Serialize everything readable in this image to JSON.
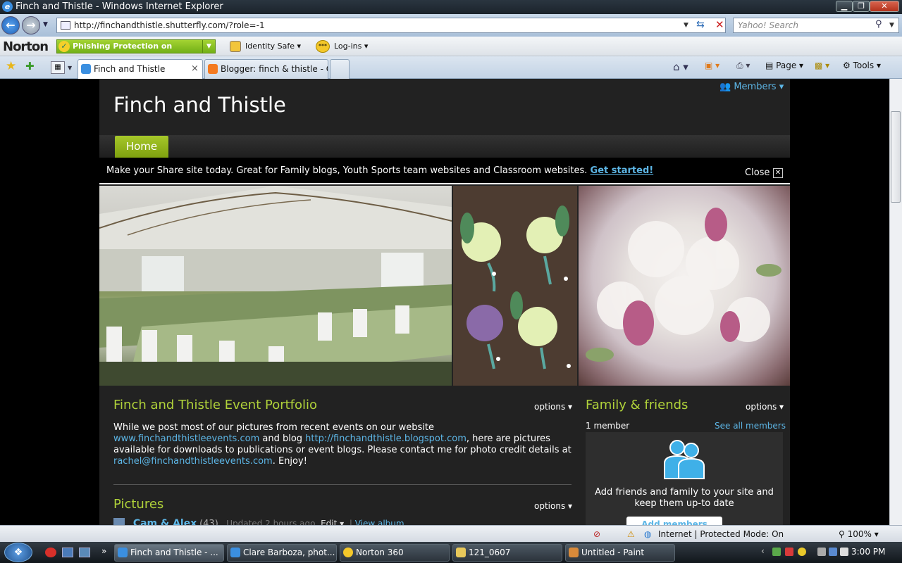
{
  "window": {
    "title": "Finch and Thistle - Windows Internet Explorer"
  },
  "nav": {
    "url": "http://finchandthistle.shutterfly.com/?role=-1",
    "search_placeholder": "Yahoo! Search"
  },
  "norton": {
    "logo": "Norton",
    "phishing": "Phishing Protection on",
    "identity_safe": "Identity Safe",
    "logins": "Log-ins"
  },
  "tabs": [
    {
      "label": "Finch and Thistle",
      "active": true
    },
    {
      "label": "Blogger: finch & thistle - C...",
      "active": false
    }
  ],
  "commands": {
    "page": "Page",
    "tools": "Tools"
  },
  "site": {
    "title": "Finch and Thistle",
    "members_menu": "Members",
    "home_tab": "Home",
    "promo_text": "Make your Share site today. Great for Family blogs, Youth Sports team websites and Classroom websites.",
    "promo_link": "Get started!",
    "promo_close": "Close",
    "portfolio": {
      "title": "Finch and Thistle Event Portfolio",
      "options": "options",
      "text1": "While we post most of our pictures from recent events on our website ",
      "link1": "www.finchandthistleevents.com",
      "text2": " and blog ",
      "link2": "http://finchandthistle.blogspot.com",
      "text3": ", here are pictures available for downloads to publications or event blogs. Please contact me for photo credit details at ",
      "link3": "rachel@finchandthistleevents.com",
      "text4": ". Enjoy!"
    },
    "pictures": {
      "title": "Pictures",
      "options": "options",
      "album_name": "Cam & Alex",
      "album_count": "(43)",
      "album_updated": "Updated 2 hours ago",
      "album_edit": "Edit",
      "album_view": "View album"
    },
    "family": {
      "title": "Family & friends",
      "options": "options",
      "count": "1 member",
      "see_all": "See all members",
      "message": "Add friends and family to your site and keep them up-to date",
      "add_button": "Add members"
    }
  },
  "status": {
    "zone": "Internet | Protected Mode: On",
    "zoom": "100%"
  },
  "taskbar": {
    "items": [
      {
        "label": "Finch and Thistle - ..."
      },
      {
        "label": "Clare Barboza, phot..."
      },
      {
        "label": "Norton 360"
      },
      {
        "label": "121_0607"
      },
      {
        "label": "Untitled - Paint"
      }
    ],
    "clock": "3:00 PM"
  },
  "colors": {
    "accent_green": "#b0d23a",
    "link_blue": "#5db6e6",
    "site_bg": "#222222"
  }
}
